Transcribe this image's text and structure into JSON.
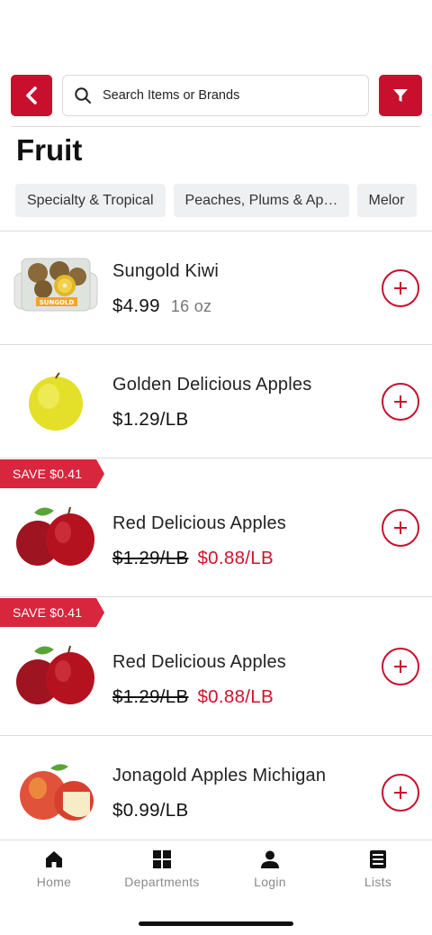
{
  "search": {
    "placeholder": "Search Items or Brands"
  },
  "page": {
    "title": "Fruit"
  },
  "categories": [
    "Specialty & Tropical",
    "Peaches, Plums & Ap…",
    "Melor"
  ],
  "products": [
    {
      "name": "Sungold Kiwi",
      "price": "$4.99",
      "size": "16 oz",
      "package_label": "SUNGOLD"
    },
    {
      "name": "Golden Delicious Apples",
      "price": "$1.29/LB"
    },
    {
      "name": "Red Delicious Apples",
      "old_price": "$1.29/LB",
      "sale_price": "$0.88/LB",
      "badge": "SAVE $0.41"
    },
    {
      "name": "Red Delicious Apples",
      "old_price": "$1.29/LB",
      "sale_price": "$0.88/LB",
      "badge": "SAVE $0.41"
    },
    {
      "name": "Jonagold Apples Michigan",
      "price": "$0.99/LB"
    }
  ],
  "nav": [
    {
      "label": "Home",
      "icon": "home-icon"
    },
    {
      "label": "Departments",
      "icon": "grid-icon"
    },
    {
      "label": "Login",
      "icon": "person-icon"
    },
    {
      "label": "Lists",
      "icon": "list-icon"
    }
  ],
  "colors": {
    "accent": "#c8102e",
    "sale": "#d0122b",
    "chip_bg": "#eff0f2"
  }
}
